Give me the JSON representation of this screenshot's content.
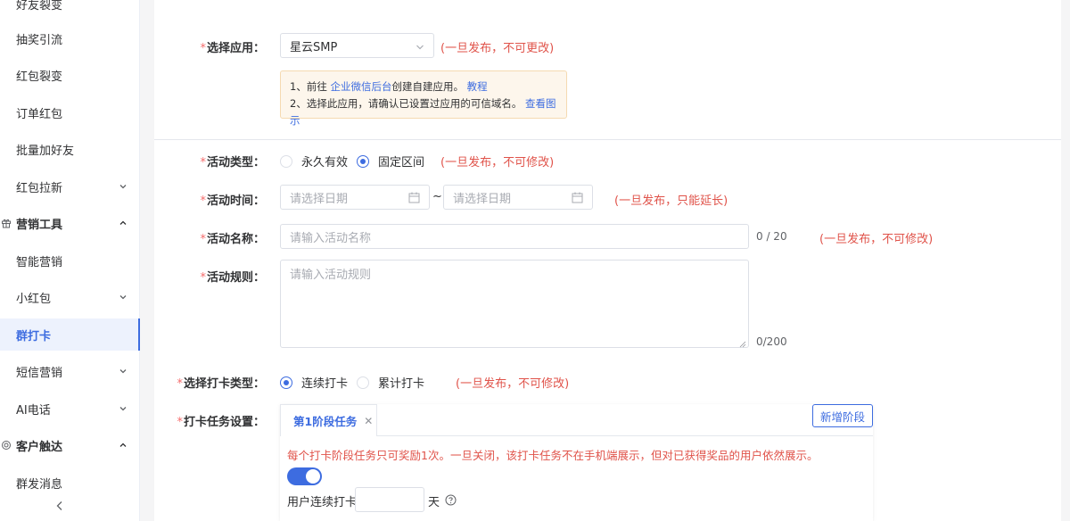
{
  "sidebar": {
    "items": [
      {
        "label": "好友裂变",
        "has_chevron": false
      },
      {
        "label": "抽奖引流",
        "has_chevron": false
      },
      {
        "label": "红包裂变",
        "has_chevron": false
      },
      {
        "label": "订单红包",
        "has_chevron": false
      },
      {
        "label": "批量加好友",
        "has_chevron": false
      },
      {
        "label": "红包拉新",
        "has_chevron": true
      },
      {
        "label": "营销工具",
        "group": true,
        "icon": "gift-icon",
        "expanded": true
      },
      {
        "label": "智能营销",
        "has_chevron": false
      },
      {
        "label": "小红包",
        "has_chevron": true
      },
      {
        "label": "群打卡",
        "active": true
      },
      {
        "label": "短信营销",
        "has_chevron": true
      },
      {
        "label": "AI电话",
        "has_chevron": true
      },
      {
        "label": "客户触达",
        "group": true,
        "icon": "target-icon",
        "expanded": true
      },
      {
        "label": "群发消息",
        "has_chevron": false
      }
    ],
    "collapse_icon": "chevron-left-icon"
  },
  "form": {
    "app": {
      "label": "选择应用：",
      "value": "星云SMP",
      "hint": "(一旦发布，不可更改)"
    },
    "notice": {
      "line1_prefix": "1、前往 ",
      "line1_link": "企业微信后台",
      "line1_suffix": "创建自建应用。 ",
      "line1_link2": "教程",
      "line2_prefix": "2、选择此应用，请确认已设置过应用的可信域名。 ",
      "line2_link": "查看图示"
    },
    "activity_type": {
      "label": "活动类型：",
      "options": [
        "永久有效",
        "固定区间"
      ],
      "selected": "固定区间",
      "hint": "(一旦发布，不可修改)"
    },
    "activity_time": {
      "label": "活动时间：",
      "start_placeholder": "请选择日期",
      "end_placeholder": "请选择日期",
      "separator": "~",
      "hint": "(一旦发布，只能延长)"
    },
    "activity_name": {
      "label": "活动名称：",
      "placeholder": "请输入活动名称",
      "counter": "0 / 20",
      "hint": "(一旦发布，不可修改)"
    },
    "activity_rules": {
      "label": "活动规则：",
      "placeholder": "请输入活动规则",
      "counter": "0/200"
    },
    "checkin_type": {
      "label": "选择打卡类型：",
      "options": [
        "连续打卡",
        "累计打卡"
      ],
      "selected": "连续打卡",
      "hint": "(一旦发布，不可修改)"
    },
    "task_settings": {
      "label": "打卡任务设置：",
      "tab_label": "第1阶段任务",
      "add_button": "新增阶段",
      "note": "每个打卡阶段任务只可奖励1次。一旦关闭，该打卡任务不在手机端展示，但对已获得奖品的用户依然展示。",
      "toggle_on": true,
      "continuous_label": "用户连续打卡",
      "days_unit": "天"
    }
  },
  "colors": {
    "primary": "#3d6ce0",
    "danger": "#e0534a",
    "warning_bg": "#fdf6ec"
  }
}
